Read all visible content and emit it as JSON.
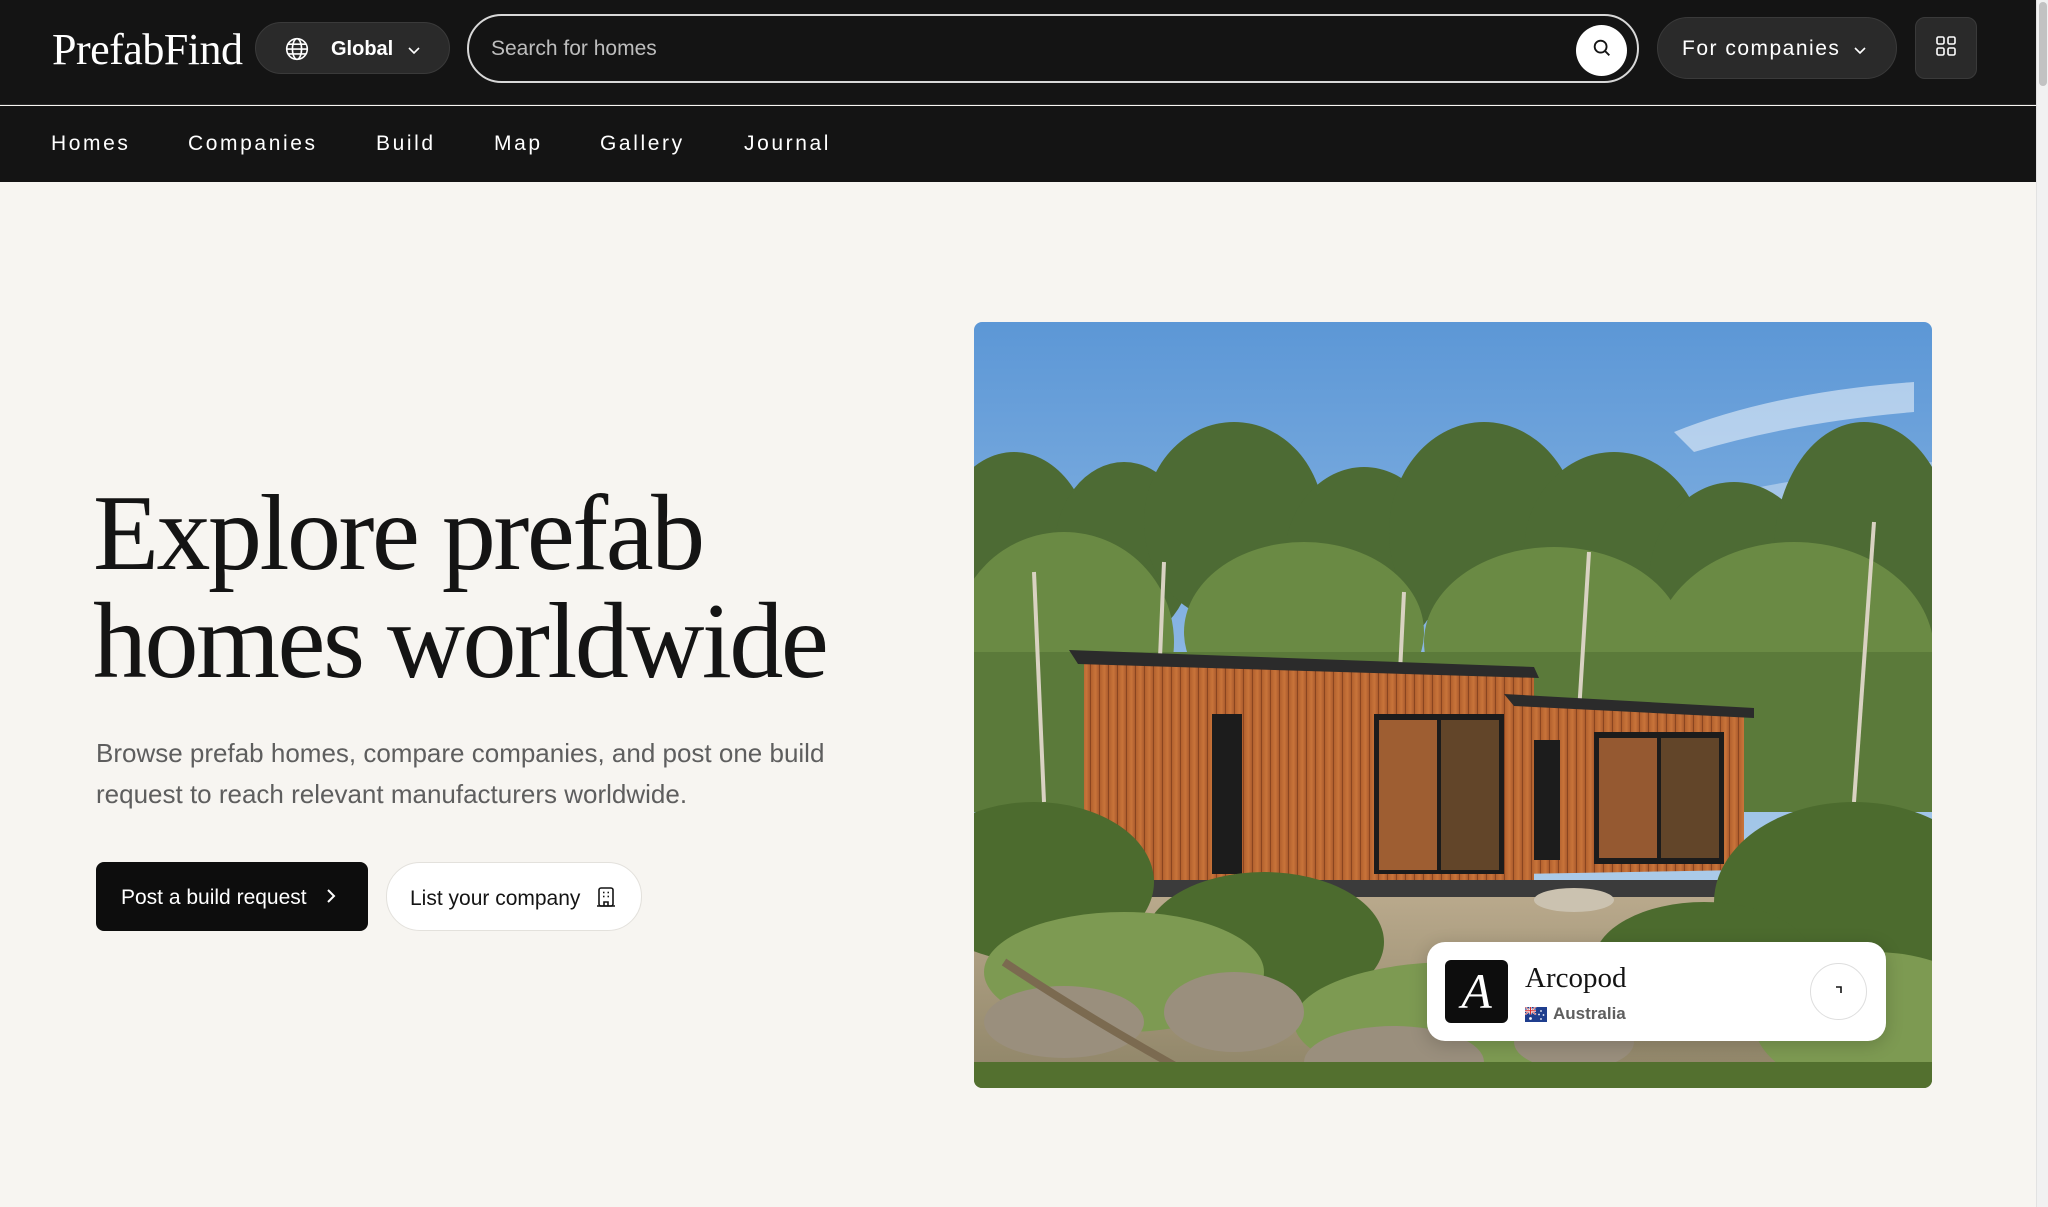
{
  "brand": {
    "logo": "PrefabFind"
  },
  "header": {
    "region_label": "Global",
    "search_placeholder": "Search for homes",
    "for_companies_label": "For companies"
  },
  "nav": {
    "items": [
      "Homes",
      "Companies",
      "Build",
      "Map",
      "Gallery",
      "Journal"
    ]
  },
  "hero": {
    "title_line1": "Explore prefab",
    "title_line2": "homes worldwide",
    "subtitle": "Browse prefab homes, compare companies, and post one build request to reach relevant manufacturers worldwide.",
    "primary_cta": "Post a build request",
    "secondary_cta": "List your company"
  },
  "featured_company": {
    "logo_letter": "A",
    "name": "Arcopod",
    "country": "Australia"
  },
  "icons": {
    "region": "globe-icon",
    "search": "search-icon",
    "menu": "grid-menu-icon",
    "primary_cta": "chevron-right-icon",
    "secondary_cta": "building-icon",
    "company_link": "arrow-icon"
  },
  "colors": {
    "header_bg": "#141414",
    "page_bg": "#f7f5f1",
    "primary_button": "#0d0d0d",
    "text_muted": "#5e5e5e"
  }
}
